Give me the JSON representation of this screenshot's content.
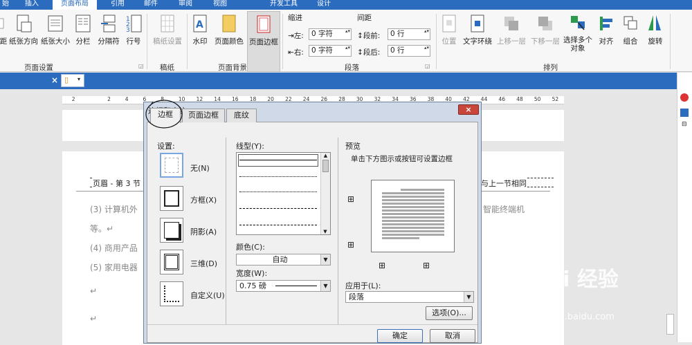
{
  "menu_tabs": [
    "始",
    "插入",
    "页面布局",
    "引用",
    "邮件",
    "审阅",
    "视图",
    "开发工具",
    "设计"
  ],
  "ribbon": {
    "page_setup": {
      "buttons": [
        "距",
        "纸张方向",
        "纸张大小",
        "分栏",
        "分隔符",
        "行号"
      ],
      "group": "页面设置"
    },
    "draft": {
      "button": "稿纸设置",
      "group": "稿纸"
    },
    "page_bg": {
      "buttons": [
        "水印",
        "页面颜色",
        "页面边框"
      ],
      "group": "页面背景"
    },
    "paragraph": {
      "indent_title": "缩进",
      "indent_left_label": "左:",
      "indent_left_value": "0 字符",
      "indent_right_label": "右:",
      "indent_right_value": "0 字符",
      "spacing_title": "间距",
      "before_label": "段前:",
      "before_value": "0 行",
      "after_label": "段后:",
      "after_value": "0 行",
      "group": "段落"
    },
    "arrange": {
      "buttons": [
        "位置",
        "文字环绕",
        "上移一层",
        "下移一层",
        "选择多个对象",
        "对齐",
        "组合",
        "旋转"
      ],
      "group": "排列"
    }
  },
  "document": {
    "header_left": "页眉 - 第 3 节 -",
    "header_right": "与上一节相同",
    "lines": [
      "(3) 计算机外",
      "等。↵",
      "(4) 商用产品",
      "(5) 家用电器",
      "↵",
      "↵"
    ],
    "line_right": "智能终端机",
    "ruler": [
      "4",
      "2",
      "",
      "2",
      "4",
      "6",
      "8",
      "10",
      "12",
      "14",
      "16",
      "18",
      "20",
      "22",
      "24",
      "26",
      "28",
      "30",
      "32",
      "34",
      "36",
      "38",
      "40",
      "42",
      "44",
      "46",
      "48",
      "50",
      "52"
    ]
  },
  "dialog": {
    "title": "边框和底纹",
    "tabs": [
      "边框",
      "页面边框",
      "底纹"
    ],
    "setting_label": "设置:",
    "settings": [
      "无(N)",
      "方框(X)",
      "阴影(A)",
      "三维(D)",
      "自定义(U)"
    ],
    "style_label": "线型(Y):",
    "color_label": "颜色(C):",
    "color_value": "自动",
    "width_label": "宽度(W):",
    "width_value": "0.75 磅",
    "preview_label": "预览",
    "preview_hint": "单击下方图示或按钮可设置边框",
    "apply_label": "应用于(L):",
    "apply_value": "段落",
    "options_button": "选项(O)...",
    "ok_button": "确定",
    "cancel_button": "取消"
  },
  "watermark": {
    "brand": "Bai 经验",
    "url": "jingyan.baidu.com"
  },
  "colors": {
    "accent": "#2b6cbf",
    "ribbon_bg": "#f7f7f7",
    "dialog_frame": "#cfd9e8"
  }
}
